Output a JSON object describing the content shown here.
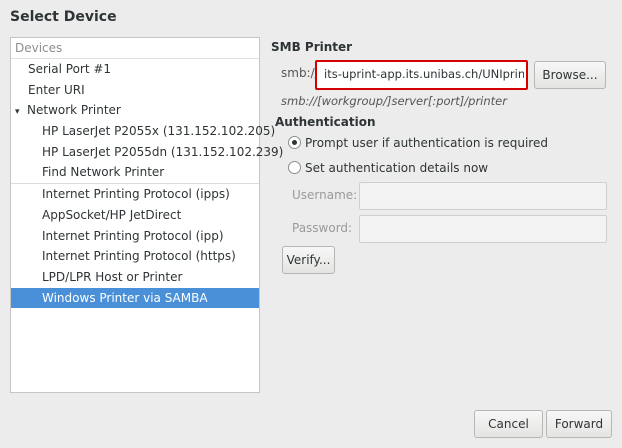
{
  "title": "Select Device",
  "devices": {
    "header": "Devices",
    "items": [
      {
        "label": "Serial Port #1"
      },
      {
        "label": "Enter URI"
      },
      {
        "label": "Network Printer"
      },
      {
        "label": "HP LaserJet P2055x (131.152.102.205)"
      },
      {
        "label": "HP LaserJet P2055dn (131.152.102.239)"
      },
      {
        "label": "Find Network Printer"
      },
      {
        "label": "Internet Printing Protocol (ipps)"
      },
      {
        "label": "AppSocket/HP JetDirect"
      },
      {
        "label": "Internet Printing Protocol (ipp)"
      },
      {
        "label": "Internet Printing Protocol (https)"
      },
      {
        "label": "LPD/LPR Host or Printer"
      },
      {
        "label": "Windows Printer via SAMBA"
      }
    ],
    "expander_icon": "▾"
  },
  "smb": {
    "title": "SMB Printer",
    "prefix": "smb://",
    "uri_value": "its-uprint-app.its.unibas.ch/UNIprint",
    "browse_label": "Browse...",
    "hint": "smb://[workgroup/]server[:port]/printer"
  },
  "auth": {
    "title": "Authentication",
    "prompt_label": "Prompt user if authentication is required",
    "set_label": "Set authentication details now",
    "username_label": "Username:",
    "password_label": "Password:",
    "verify_label": "Verify..."
  },
  "footer": {
    "cancel_label": "Cancel",
    "forward_label": "Forward"
  },
  "colors": {
    "selection": "#4a90d9",
    "highlight_border": "#d40000"
  }
}
